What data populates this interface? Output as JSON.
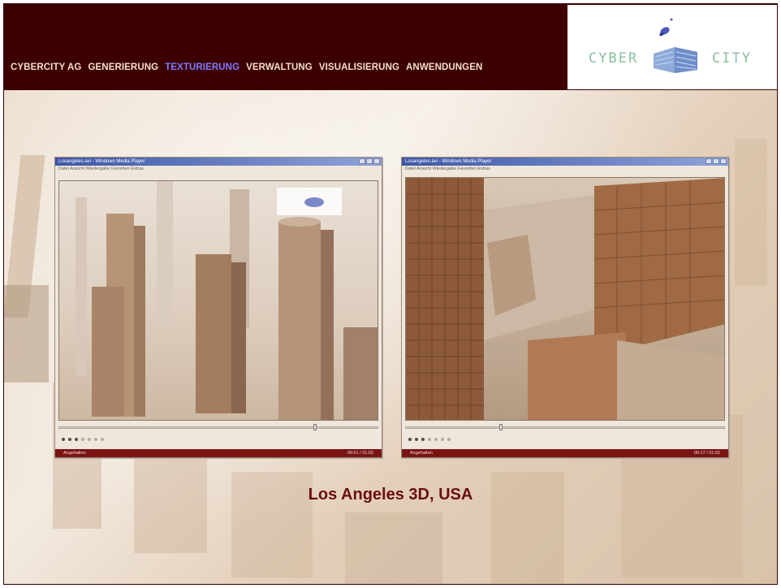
{
  "nav": {
    "items": [
      {
        "label": "CYBERCITY AG"
      },
      {
        "label": "GENERIERUNG"
      },
      {
        "label": "TEXTURIERUNG"
      },
      {
        "label": "VERWALTUNG"
      },
      {
        "label": "VISUALISIERUNG"
      },
      {
        "label": "ANWENDUNGEN"
      }
    ],
    "active_index": 2
  },
  "logo": {
    "left_text": "CYBER",
    "right_text": "CITY"
  },
  "windows": [
    {
      "title": "Losangeles.avi - Windows Media Player",
      "menu": "Datei  Ansicht  Wiedergabe  Favoriten  Extras",
      "status_left": "Angehalten",
      "status_right": "00:01 / 01:02"
    },
    {
      "title": "Losangeles.avi - Windows Media Player",
      "menu": "Datei  Ansicht  Wiedergabe  Favoriten  Extras",
      "status_left": "Angehalten",
      "status_right": "00:17 / 01:02"
    }
  ],
  "caption": "Los Angeles 3D, USA",
  "colors": {
    "header_bg": "#3d0000",
    "nav_text": "#f0e0c8",
    "nav_active": "#7a7cff",
    "caption": "#6b0f0f"
  }
}
